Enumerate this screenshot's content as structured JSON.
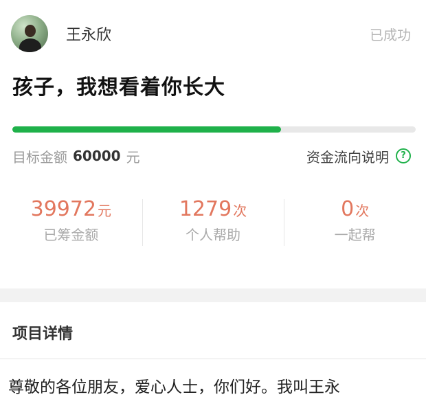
{
  "creator": {
    "name": "王永欣",
    "avatar_icon": "avatar-photo"
  },
  "status": "已成功",
  "project_title": "孩子，我想看着你长大",
  "progress": {
    "percent": 66.6,
    "color": "#1fb14a"
  },
  "target": {
    "label": "目标金额",
    "amount": "60000",
    "unit": "元"
  },
  "funds_link": {
    "label": "资金流向说明",
    "icon": "question-circle-icon"
  },
  "stats": [
    {
      "value": "39972",
      "unit": "元",
      "label": "已筹金额"
    },
    {
      "value": "1279",
      "unit": "次",
      "label": "个人帮助"
    },
    {
      "value": "0",
      "unit": "次",
      "label": "一起帮"
    }
  ],
  "details": {
    "title": "项目详情",
    "text": "尊敬的各位朋友，爱心人士，你们好。我叫王永"
  },
  "colors": {
    "accent": "#1fb14a",
    "stat": "#e2775e",
    "muted": "#aaaaaa"
  }
}
